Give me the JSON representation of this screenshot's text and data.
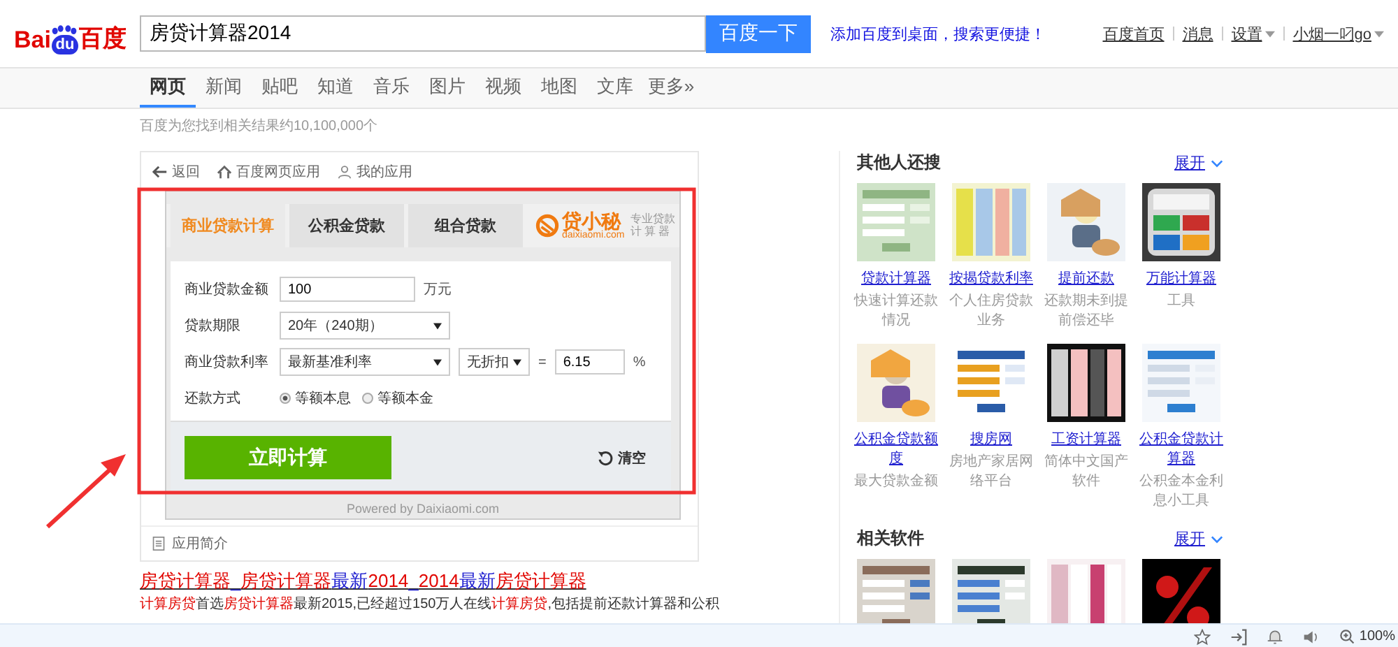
{
  "header": {
    "logo": {
      "parts": [
        "Bai",
        "du",
        "百度"
      ]
    },
    "search": {
      "value": "房贷计算器2014"
    },
    "search_button": "百度一下",
    "promo_link": "添加百度到桌面，搜索更便捷！",
    "user_links": [
      {
        "label": "百度首页",
        "dropdown": false
      },
      {
        "label": "消息",
        "dropdown": false
      },
      {
        "label": "设置",
        "dropdown": true
      },
      {
        "label": "小烟一叼go",
        "dropdown": true
      }
    ]
  },
  "nav_tabs": [
    {
      "label": "网页",
      "selected": true
    },
    {
      "label": "新闻",
      "selected": false
    },
    {
      "label": "贴吧",
      "selected": false
    },
    {
      "label": "知道",
      "selected": false
    },
    {
      "label": "音乐",
      "selected": false
    },
    {
      "label": "图片",
      "selected": false
    },
    {
      "label": "视频",
      "selected": false
    },
    {
      "label": "地图",
      "selected": false
    },
    {
      "label": "文库",
      "selected": false
    },
    {
      "label": "更多»",
      "selected": false
    }
  ],
  "result_count": "百度为您找到相关结果约10,100,000个",
  "app_card": {
    "toolbar": [
      {
        "kind": "back",
        "label": "返回"
      },
      {
        "kind": "home",
        "label": "百度网页应用"
      },
      {
        "kind": "user",
        "label": "我的应用"
      }
    ],
    "calculator": {
      "tabs": [
        {
          "label": "商业贷款计算",
          "selected": true
        },
        {
          "label": "公积金贷款",
          "selected": false
        },
        {
          "label": "组合贷款",
          "selected": false
        }
      ],
      "brand": {
        "name": "贷小秘",
        "domain": "daixiaomi.com",
        "tagline_1": "专业贷款",
        "tagline_2": "计 算 器"
      },
      "fields": [
        {
          "kind": "input",
          "label": "商业贷款金额",
          "value": "100",
          "unit": "万元"
        },
        {
          "kind": "select",
          "label": "贷款期限",
          "value": "20年（240期）"
        },
        {
          "kind": "rate",
          "label": "商业贷款利率",
          "value": "最新基准利率",
          "discount": "无折扣",
          "equals": "=",
          "rate": "6.15",
          "unit": "%"
        },
        {
          "kind": "radio",
          "label": "还款方式",
          "options": [
            {
              "label": "等额本息",
              "selected": true
            },
            {
              "label": "等额本金",
              "selected": false
            }
          ]
        }
      ],
      "submit": "立即计算",
      "clear": "清空",
      "powered_by": "Powered by Daixiaomi.com"
    },
    "footer_link": "应用简介"
  },
  "result": {
    "title_parts": [
      {
        "text": "房贷计算器",
        "highlight": true
      },
      {
        "text": "_",
        "highlight": false
      },
      {
        "text": "房贷计算器",
        "highlight": true
      },
      {
        "text": "最新",
        "highlight": false
      },
      {
        "text": "2014",
        "highlight": true
      },
      {
        "text": "_",
        "highlight": false
      },
      {
        "text": "2014",
        "highlight": true
      },
      {
        "text": "最新",
        "highlight": false
      },
      {
        "text": "房贷计算器",
        "highlight": true
      }
    ],
    "snippet_parts": [
      {
        "text": "计算房贷",
        "highlight": true
      },
      {
        "text": "首选",
        "highlight": false
      },
      {
        "text": "房贷计算器",
        "highlight": true
      },
      {
        "text": "最新2015,已经超过150万人在线",
        "highlight": false
      },
      {
        "text": "计算房贷",
        "highlight": true
      },
      {
        "text": ",包括提前还款计算器和公积",
        "highlight": false
      }
    ]
  },
  "sidebar": [
    {
      "title": "其他人还搜",
      "expand": "展开",
      "items": [
        {
          "kind": "link",
          "name": "贷款计算器",
          "desc": "快速计算还款情况"
        },
        {
          "kind": "link",
          "name": "按揭贷款利率",
          "desc": "个人住房贷款业务"
        },
        {
          "kind": "link",
          "name": "提前还款",
          "desc": "还款期未到提前偿还毕"
        },
        {
          "kind": "link",
          "name": "万能计算器",
          "desc": "工具"
        },
        {
          "kind": "link",
          "name": "公积金贷款额度",
          "desc": "最大贷款金额"
        },
        {
          "kind": "link",
          "name": "搜房网",
          "desc": "房地产家居网络平台"
        },
        {
          "kind": "link",
          "name": "工资计算器",
          "desc": "简体中文国产软件"
        },
        {
          "kind": "link",
          "name": "公积金贷款计算器",
          "desc": "公积金本金利息小工具"
        }
      ]
    },
    {
      "title": "相关软件",
      "expand": "展开"
    }
  ],
  "status_bar": {
    "zoom": "100%"
  }
}
